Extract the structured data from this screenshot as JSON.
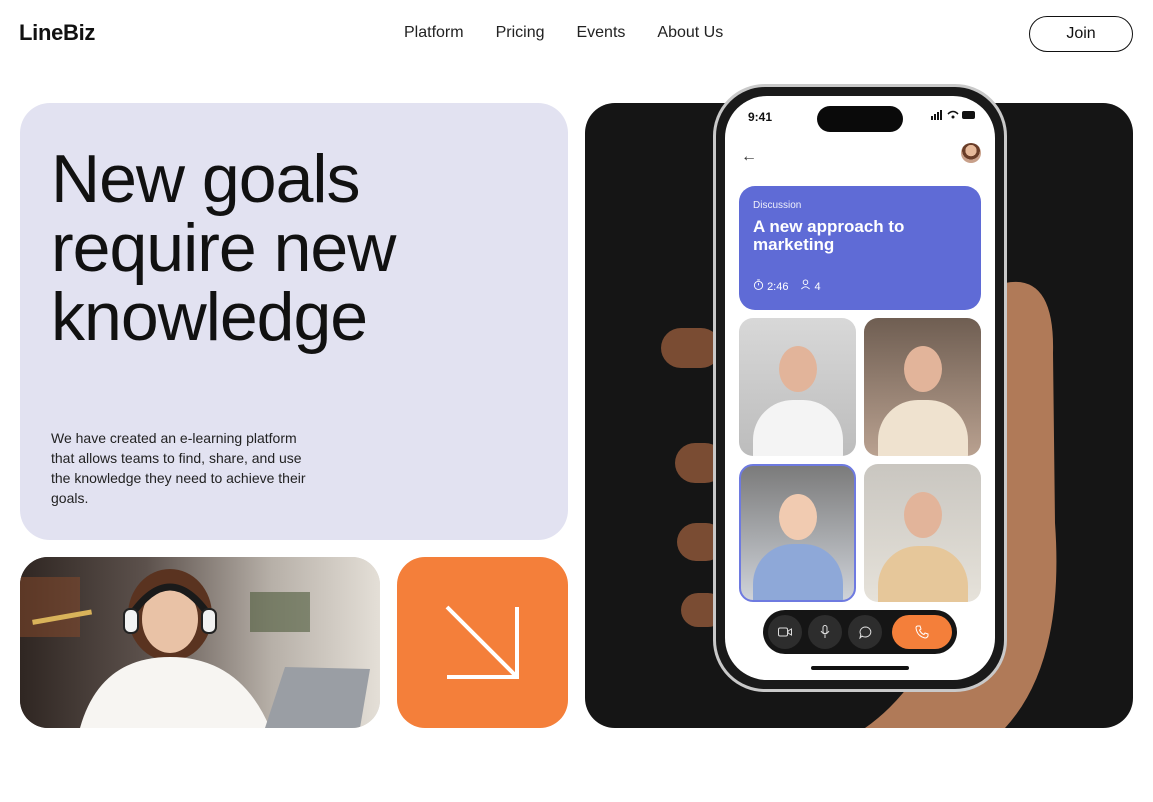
{
  "header": {
    "logo": "LineBiz",
    "nav": [
      "Platform",
      "Pricing",
      "Events",
      "About Us"
    ],
    "join_label": "Join"
  },
  "hero": {
    "headline": [
      "New goals",
      "require new",
      "knowledge"
    ],
    "description": "We have created an e-learning platform that allows teams to find, share, and use the knowledge they need to achieve their goals."
  },
  "phone": {
    "status_time": "9:41",
    "discussion": {
      "label": "Discussion",
      "title": "A new approach to marketing",
      "duration": "2:46",
      "participants": "4"
    }
  },
  "colors": {
    "hero_bg": "#e2e2f1",
    "accent_orange": "#f47f3a",
    "accent_blue": "#5f6bd6",
    "dark_panel": "#151515"
  }
}
